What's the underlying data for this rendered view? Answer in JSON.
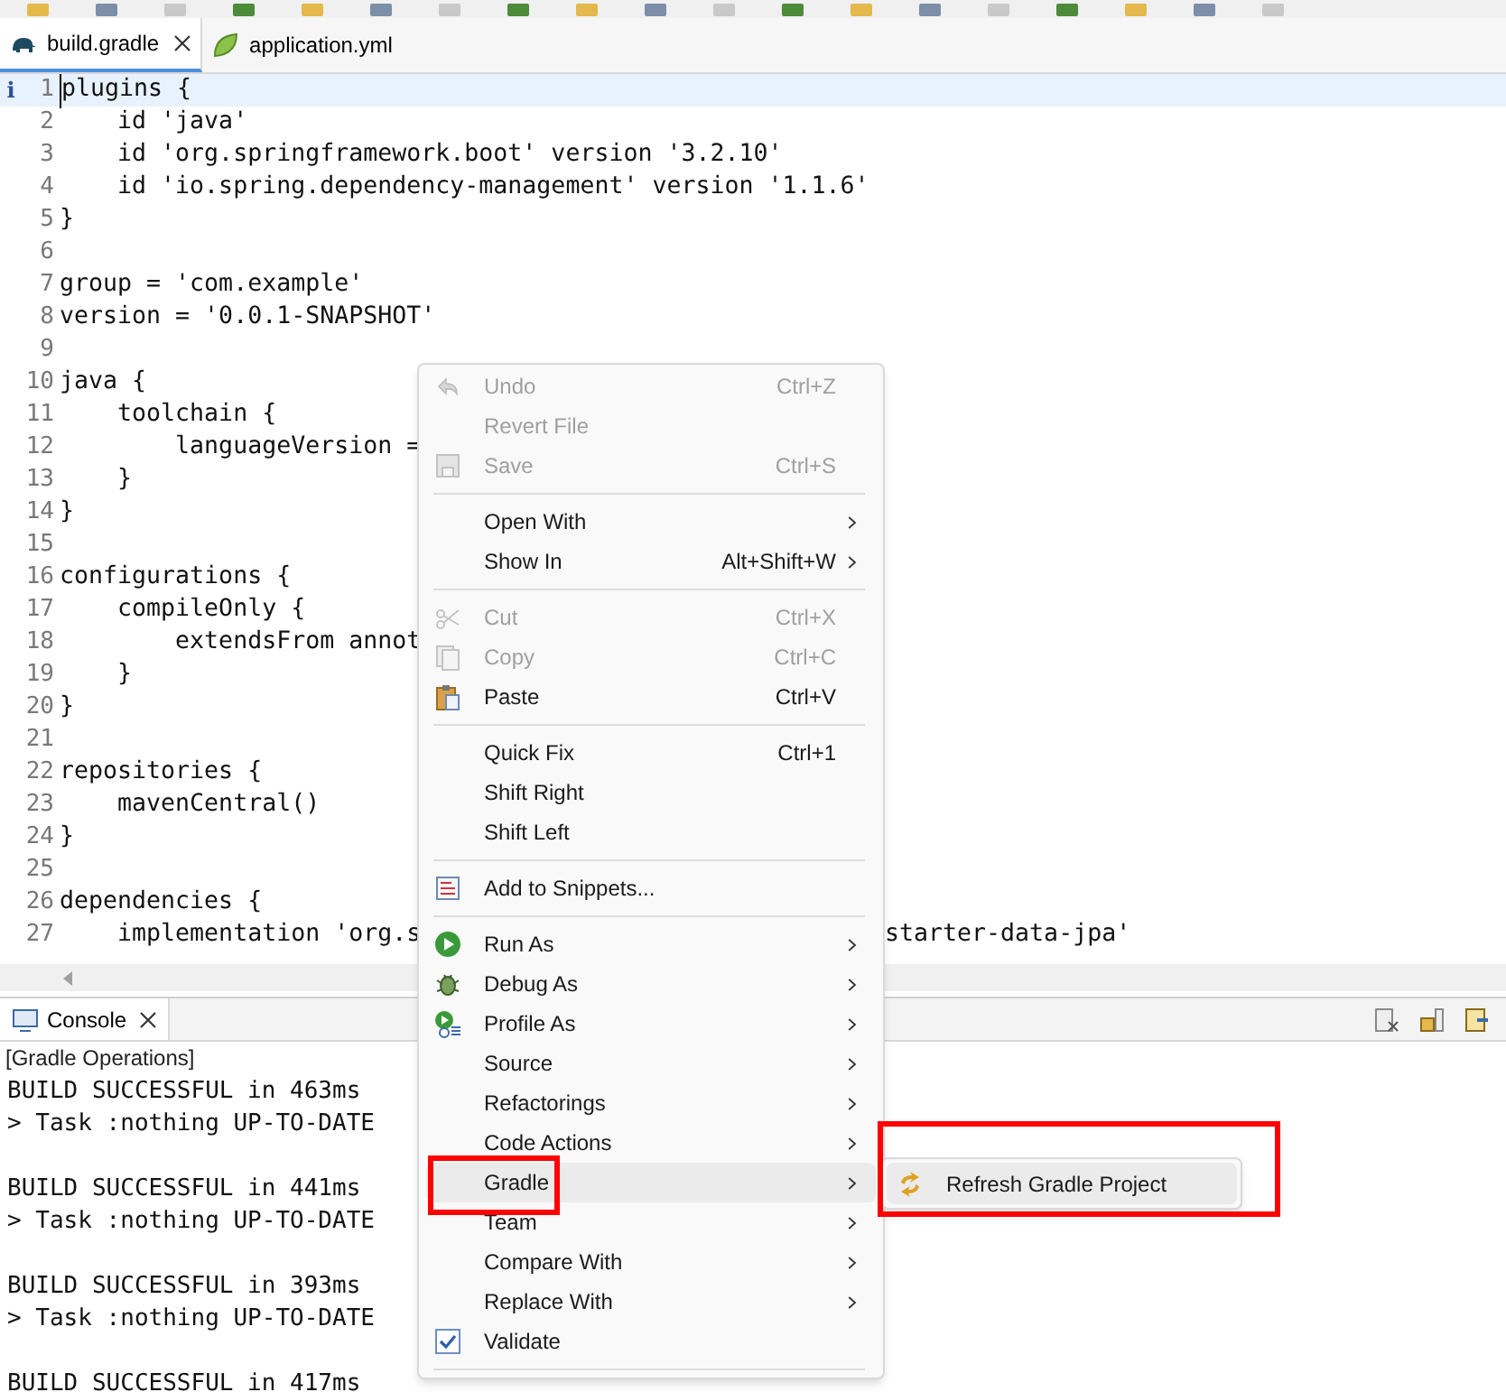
{
  "editor_tabs": [
    {
      "label": "build.gradle",
      "selected": true,
      "closable": true
    },
    {
      "label": "application.yml",
      "selected": false,
      "closable": false
    }
  ],
  "editor": {
    "lines": [
      {
        "number": "1",
        "text": "plugins {",
        "current": true,
        "marker": "i"
      },
      {
        "number": "2",
        "text": "    id 'java'",
        "current": false
      },
      {
        "number": "3",
        "text": "    id 'org.springframework.boot' version '3.2.10'",
        "current": false
      },
      {
        "number": "4",
        "text": "    id 'io.spring.dependency-management' version '1.1.6'",
        "current": false
      },
      {
        "number": "5",
        "text": "}",
        "current": false
      },
      {
        "number": "6",
        "current": false
      },
      {
        "number": "7",
        "text": "group = 'com.example'",
        "current": false
      },
      {
        "number": "8",
        "text": "version = '0.0.1-SNAPSHOT'",
        "current": false
      },
      {
        "number": "9",
        "current": false
      },
      {
        "number": "10",
        "text": "java {",
        "current": false
      },
      {
        "number": "11",
        "text": "    toolchain {",
        "current": false
      },
      {
        "number": "12",
        "text": "        languageVersion =",
        "current": false
      },
      {
        "number": "13",
        "text": "    }",
        "current": false
      },
      {
        "number": "14",
        "text": "}",
        "current": false
      },
      {
        "number": "15",
        "current": false
      },
      {
        "number": "16",
        "text": "configurations {",
        "current": false
      },
      {
        "number": "17",
        "text": "    compileOnly {",
        "current": false
      },
      {
        "number": "18",
        "text": "        extendsFrom annot",
        "current": false
      },
      {
        "number": "19",
        "text": "    }",
        "current": false
      },
      {
        "number": "20",
        "text": "}",
        "current": false
      },
      {
        "number": "21",
        "current": false
      },
      {
        "number": "22",
        "text": "repositories {",
        "current": false
      },
      {
        "number": "23",
        "text": "    mavenCentral()",
        "current": false
      },
      {
        "number": "24",
        "text": "}",
        "current": false
      },
      {
        "number": "25",
        "current": false
      },
      {
        "number": "26",
        "text": "dependencies {",
        "current": false
      },
      {
        "number": "27",
        "text": "    implementation 'org.s",
        "text_right": "starter-data-jpa'",
        "current": false
      }
    ]
  },
  "console": {
    "tab": {
      "label": "Console",
      "selected": true
    },
    "title": "[Gradle Operations]",
    "blocks": [
      {
        "lines": [
          "BUILD SUCCESSFUL in 463ms",
          "> Task :nothing UP-TO-DATE"
        ]
      },
      {
        "lines": [
          "BUILD SUCCESSFUL in 441ms",
          "> Task :nothing UP-TO-DATE"
        ]
      },
      {
        "lines": [
          "BUILD SUCCESSFUL in 393ms",
          "> Task :nothing UP-TO-DATE"
        ]
      },
      {
        "lines": [
          "BUILD SUCCESSFUL in 417ms"
        ]
      }
    ]
  },
  "context_menu": {
    "items": [
      {
        "kind": "item",
        "label": "Undo",
        "shortcut": "Ctrl+Z",
        "disabled": true,
        "submenu": false,
        "selected": false
      },
      {
        "kind": "item",
        "label": "Revert File",
        "disabled": true,
        "submenu": false,
        "selected": false
      },
      {
        "kind": "item",
        "label": "Save",
        "shortcut": "Ctrl+S",
        "disabled": true,
        "submenu": false,
        "selected": false
      },
      {
        "kind": "separator"
      },
      {
        "kind": "item",
        "label": "Open With",
        "disabled": false,
        "submenu": true,
        "selected": false
      },
      {
        "kind": "item",
        "label": "Show In",
        "shortcut": "Alt+Shift+W",
        "disabled": false,
        "submenu": true,
        "selected": false
      },
      {
        "kind": "separator"
      },
      {
        "kind": "item",
        "label": "Cut",
        "shortcut": "Ctrl+X",
        "disabled": true,
        "submenu": false,
        "selected": false
      },
      {
        "kind": "item",
        "label": "Copy",
        "shortcut": "Ctrl+C",
        "disabled": true,
        "submenu": false,
        "selected": false
      },
      {
        "kind": "item",
        "label": "Paste",
        "shortcut": "Ctrl+V",
        "disabled": false,
        "submenu": false,
        "selected": false
      },
      {
        "kind": "separator"
      },
      {
        "kind": "item",
        "label": "Quick Fix",
        "shortcut": "Ctrl+1",
        "disabled": false,
        "submenu": false,
        "selected": false
      },
      {
        "kind": "item",
        "label": "Shift Right",
        "disabled": false,
        "submenu": false,
        "selected": false
      },
      {
        "kind": "item",
        "label": "Shift Left",
        "disabled": false,
        "submenu": false,
        "selected": false
      },
      {
        "kind": "separator"
      },
      {
        "kind": "item",
        "label": "Add to Snippets...",
        "disabled": false,
        "submenu": false,
        "selected": false
      },
      {
        "kind": "separator"
      },
      {
        "kind": "item",
        "label": "Run As",
        "disabled": false,
        "submenu": true,
        "selected": false
      },
      {
        "kind": "item",
        "label": "Debug As",
        "disabled": false,
        "submenu": true,
        "selected": false
      },
      {
        "kind": "item",
        "label": "Profile As",
        "disabled": false,
        "submenu": true,
        "selected": false
      },
      {
        "kind": "item",
        "label": "Source",
        "disabled": false,
        "submenu": true,
        "selected": false
      },
      {
        "kind": "item",
        "label": "Refactorings",
        "disabled": false,
        "submenu": true,
        "selected": false
      },
      {
        "kind": "item",
        "label": "Code Actions",
        "disabled": false,
        "submenu": true,
        "selected": false
      },
      {
        "kind": "item",
        "label": "Gradle",
        "disabled": false,
        "submenu": true,
        "selected": true
      },
      {
        "kind": "item",
        "label": "Team",
        "disabled": false,
        "submenu": true,
        "selected": false
      },
      {
        "kind": "item",
        "label": "Compare With",
        "disabled": false,
        "submenu": true,
        "selected": false
      },
      {
        "kind": "item",
        "label": "Replace With",
        "disabled": false,
        "submenu": true,
        "selected": false
      },
      {
        "kind": "check",
        "label": "Validate",
        "checked": true,
        "disabled": false,
        "submenu": false,
        "selected": false
      },
      {
        "kind": "separator"
      }
    ]
  },
  "submenu": {
    "items": [
      {
        "label": "Refresh Gradle Project",
        "selected": true
      }
    ]
  }
}
